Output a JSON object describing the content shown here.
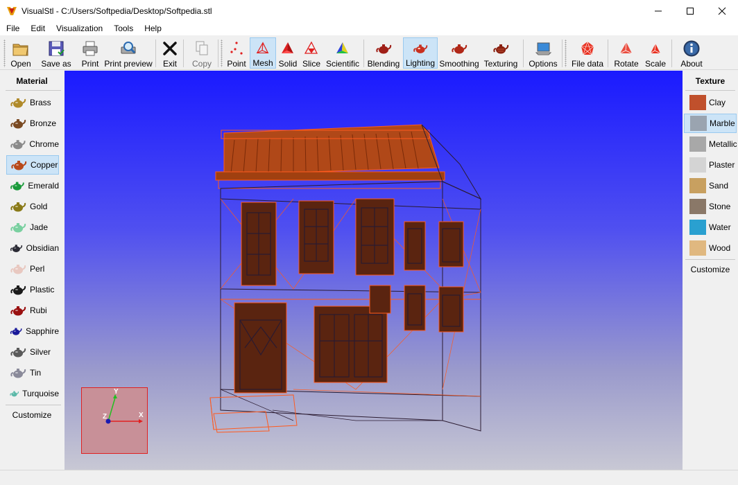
{
  "window": {
    "title": "VisualStl - C:/Users/Softpedia/Desktop/Softpedia.stl"
  },
  "menu": [
    "File",
    "Edit",
    "Visualization",
    "Tools",
    "Help"
  ],
  "toolbar": {
    "open": "Open",
    "save_as": "Save as",
    "print": "Print",
    "print_preview": "Print preview",
    "exit": "Exit",
    "copy": "Copy",
    "point": "Point",
    "mesh": "Mesh",
    "solid": "Solid",
    "slice": "Slice",
    "scientific": "Scientific",
    "blending": "Blending",
    "lighting": "Lighting",
    "smoothing": "Smoothing",
    "texturing": "Texturing",
    "options": "Options",
    "file_data": "File data",
    "rotate": "Rotate",
    "scale": "Scale",
    "about": "About"
  },
  "material_panel": {
    "title": "Material",
    "items": [
      {
        "label": "Brass",
        "color": "#b08a2a"
      },
      {
        "label": "Bronze",
        "color": "#7a4a22"
      },
      {
        "label": "Chrome",
        "color": "#8a8a8a"
      },
      {
        "label": "Copper",
        "color": "#b84a1c"
      },
      {
        "label": "Emerald",
        "color": "#1a9a3a"
      },
      {
        "label": "Gold",
        "color": "#8a7a18"
      },
      {
        "label": "Jade",
        "color": "#7ad0a0"
      },
      {
        "label": "Obsidian",
        "color": "#2a2a34"
      },
      {
        "label": "Perl",
        "color": "#e8c8c0"
      },
      {
        "label": "Plastic",
        "color": "#1a1a1a"
      },
      {
        "label": "Rubi",
        "color": "#9a1010"
      },
      {
        "label": "Sapphire",
        "color": "#1a1a9a"
      },
      {
        "label": "Silver",
        "color": "#5a5a5a"
      },
      {
        "label": "Tin",
        "color": "#8a8a9a"
      },
      {
        "label": "Turquoise",
        "color": "#5ab8a8"
      }
    ],
    "selected": "Copper",
    "customize": "Customize"
  },
  "texture_panel": {
    "title": "Texture",
    "items": [
      {
        "label": "Clay",
        "color": "#c0502c"
      },
      {
        "label": "Marble",
        "color": "#9aa4b0"
      },
      {
        "label": "Metallic",
        "color": "#a8a8a8"
      },
      {
        "label": "Plaster",
        "color": "#d4d4d4"
      },
      {
        "label": "Sand",
        "color": "#c8a060"
      },
      {
        "label": "Stone",
        "color": "#8a7868"
      },
      {
        "label": "Water",
        "color": "#2aa0d0"
      },
      {
        "label": "Wood",
        "color": "#e0b880"
      }
    ],
    "selected": "Marble",
    "customize": "Customize"
  },
  "axes": {
    "x": "X",
    "y": "Y",
    "z": "Z"
  },
  "colors": {
    "selection": "#cce4f7",
    "mesh": "#ff5a1e",
    "viewport_top": "#1a1aff"
  }
}
